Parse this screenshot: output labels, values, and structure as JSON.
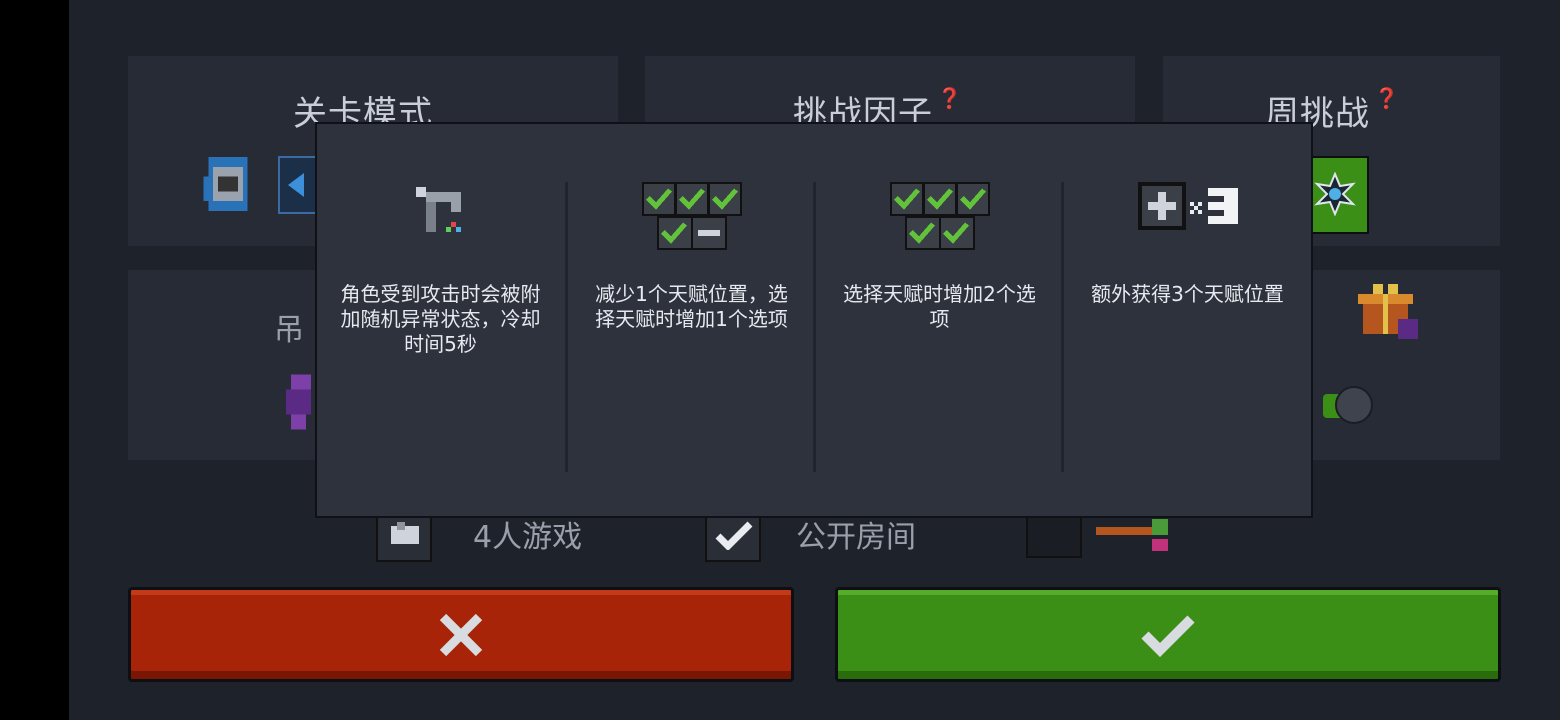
{
  "panels": {
    "level_mode_title": "关卡模式",
    "challenge_factor_title": "挑战因子",
    "weekly_challenge_title": "周挑战",
    "partial_label": "吊"
  },
  "options": {
    "players_label": "4人游戏",
    "public_room_label": "公开房间"
  },
  "popup": {
    "columns": [
      {
        "icon": "gun-icon",
        "desc": "角色受到攻击时会被附加随机异常状态，冷却时间5秒"
      },
      {
        "icon": "talent-slots-minus-icon",
        "desc": "减少1个天赋位置，选择天赋时增加1个选项"
      },
      {
        "icon": "talent-slots-check-icon",
        "desc": "选择天赋时增加2个选项"
      },
      {
        "icon": "talent-plus-x3-icon",
        "desc": "额外获得3个天赋位置"
      }
    ]
  },
  "buttons": {
    "cancel": "close-x-icon",
    "confirm": "check-icon"
  },
  "colors": {
    "cancel": "#a82408",
    "confirm": "#3c8f16",
    "popup_bg": "#2d323d"
  }
}
